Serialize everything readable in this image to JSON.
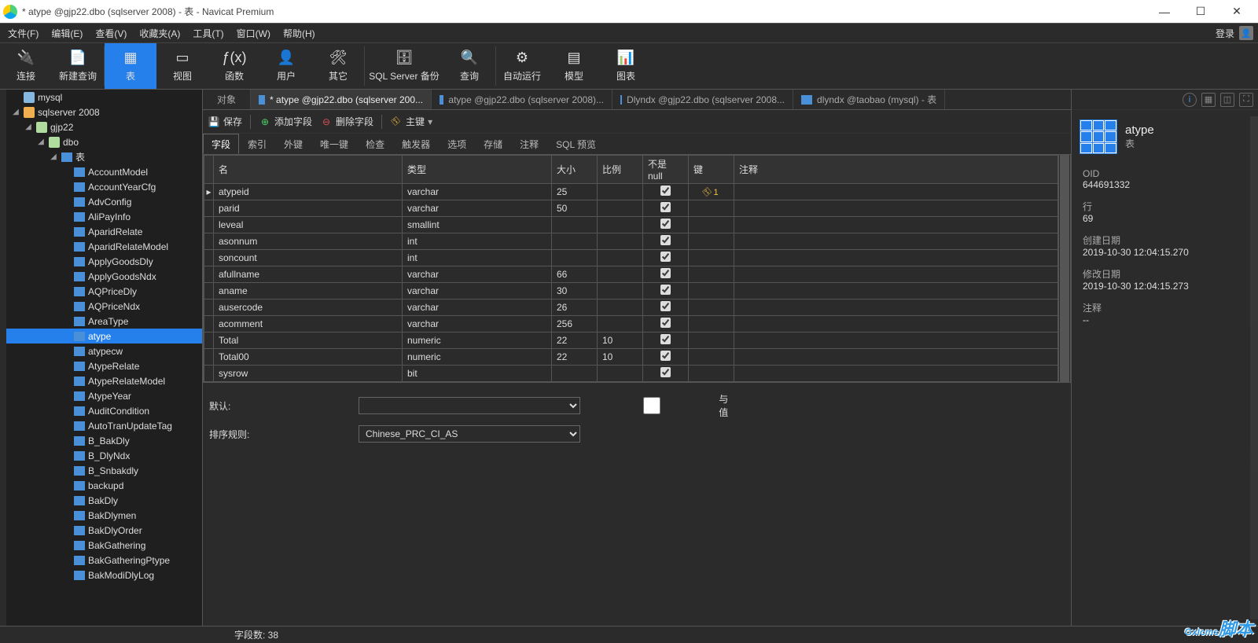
{
  "window": {
    "title": "* atype @gjp22.dbo (sqlserver 2008) - 表 - Navicat Premium"
  },
  "menu": {
    "items": [
      "文件(F)",
      "编辑(E)",
      "查看(V)",
      "收藏夹(A)",
      "工具(T)",
      "窗口(W)",
      "帮助(H)"
    ],
    "login": "登录"
  },
  "ribbon": {
    "items": [
      "连接",
      "新建查询",
      "表",
      "视图",
      "函数",
      "用户",
      "其它",
      "SQL Server 备份",
      "查询",
      "自动运行",
      "模型",
      "图表"
    ]
  },
  "tree": {
    "root": [
      {
        "label": "mysql",
        "icon": "my"
      },
      {
        "label": "sqlserver 2008",
        "icon": "sv",
        "open": true,
        "children": [
          {
            "label": "gjp22",
            "icon": "db",
            "open": true,
            "children": [
              {
                "label": "dbo",
                "icon": "db",
                "open": true,
                "children": [
                  {
                    "label": "表",
                    "icon": "tbl",
                    "open": true,
                    "children": [
                      {
                        "label": "AccountModel",
                        "icon": "tbl"
                      },
                      {
                        "label": "AccountYearCfg",
                        "icon": "tbl"
                      },
                      {
                        "label": "AdvConfig",
                        "icon": "tbl"
                      },
                      {
                        "label": "AliPayInfo",
                        "icon": "tbl"
                      },
                      {
                        "label": "AparidRelate",
                        "icon": "tbl"
                      },
                      {
                        "label": "AparidRelateModel",
                        "icon": "tbl"
                      },
                      {
                        "label": "ApplyGoodsDly",
                        "icon": "tbl"
                      },
                      {
                        "label": "ApplyGoodsNdx",
                        "icon": "tbl"
                      },
                      {
                        "label": "AQPriceDly",
                        "icon": "tbl"
                      },
                      {
                        "label": "AQPriceNdx",
                        "icon": "tbl"
                      },
                      {
                        "label": "AreaType",
                        "icon": "tbl"
                      },
                      {
                        "label": "atype",
                        "icon": "tbl",
                        "selected": true
                      },
                      {
                        "label": "atypecw",
                        "icon": "tbl"
                      },
                      {
                        "label": "AtypeRelate",
                        "icon": "tbl"
                      },
                      {
                        "label": "AtypeRelateModel",
                        "icon": "tbl"
                      },
                      {
                        "label": "AtypeYear",
                        "icon": "tbl"
                      },
                      {
                        "label": "AuditCondition",
                        "icon": "tbl"
                      },
                      {
                        "label": "AutoTranUpdateTag",
                        "icon": "tbl"
                      },
                      {
                        "label": "B_BakDly",
                        "icon": "tbl"
                      },
                      {
                        "label": "B_DlyNdx",
                        "icon": "tbl"
                      },
                      {
                        "label": "B_Snbakdly",
                        "icon": "tbl"
                      },
                      {
                        "label": "backupd",
                        "icon": "tbl"
                      },
                      {
                        "label": "BakDly",
                        "icon": "tbl"
                      },
                      {
                        "label": "BakDlymen",
                        "icon": "tbl"
                      },
                      {
                        "label": "BakDlyOrder",
                        "icon": "tbl"
                      },
                      {
                        "label": "BakGathering",
                        "icon": "tbl"
                      },
                      {
                        "label": "BakGatheringPtype",
                        "icon": "tbl"
                      },
                      {
                        "label": "BakModiDlyLog",
                        "icon": "tbl"
                      }
                    ]
                  }
                ]
              }
            ]
          }
        ]
      }
    ]
  },
  "tabs": {
    "obj": "对象",
    "items": [
      {
        "label": "* atype @gjp22.dbo (sqlserver 200...",
        "active": true
      },
      {
        "label": "atype @gjp22.dbo (sqlserver 2008)..."
      },
      {
        "label": "Dlyndx @gjp22.dbo (sqlserver 2008..."
      },
      {
        "label": "dlyndx @taobao (mysql) - 表"
      }
    ]
  },
  "toolbar2": {
    "save": "保存",
    "addfield": "添加字段",
    "delfield": "删除字段",
    "pk": "主键"
  },
  "subtabs": [
    "字段",
    "索引",
    "外键",
    "唯一键",
    "检查",
    "触发器",
    "选项",
    "存储",
    "注释",
    "SQL 预览"
  ],
  "grid": {
    "headers": [
      "名",
      "类型",
      "大小",
      "比例",
      "不是 null",
      "键",
      "注释"
    ],
    "rows": [
      {
        "ptr": true,
        "name": "atypeid",
        "type": "varchar",
        "size": "25",
        "scale": "",
        "nn": true,
        "key": "1"
      },
      {
        "name": "parid",
        "type": "varchar",
        "size": "50",
        "scale": "",
        "nn": true
      },
      {
        "name": "leveal",
        "type": "smallint",
        "size": "",
        "scale": "",
        "nn": true
      },
      {
        "name": "asonnum",
        "type": "int",
        "size": "",
        "scale": "",
        "nn": true
      },
      {
        "name": "soncount",
        "type": "int",
        "size": "",
        "scale": "",
        "nn": true
      },
      {
        "name": "afullname",
        "type": "varchar",
        "size": "66",
        "scale": "",
        "nn": true
      },
      {
        "name": "aname",
        "type": "varchar",
        "size": "30",
        "scale": "",
        "nn": true
      },
      {
        "name": "ausercode",
        "type": "varchar",
        "size": "26",
        "scale": "",
        "nn": true
      },
      {
        "name": "acomment",
        "type": "varchar",
        "size": "256",
        "scale": "",
        "nn": true
      },
      {
        "name": "Total",
        "type": "numeric",
        "size": "22",
        "scale": "10",
        "nn": true
      },
      {
        "name": "Total00",
        "type": "numeric",
        "size": "22",
        "scale": "10",
        "nn": true
      },
      {
        "name": "sysrow",
        "type": "bit",
        "size": "",
        "scale": "",
        "nn": true
      }
    ]
  },
  "form": {
    "default_label": "默认:",
    "collation_label": "排序规则:",
    "collation_value": "Chinese_PRC_CI_AS",
    "withvalue": "与值"
  },
  "right": {
    "name": "atype",
    "sub": "表",
    "props": [
      {
        "lab": "OID",
        "val": "644691332"
      },
      {
        "lab": "行",
        "val": "69"
      },
      {
        "lab": "创建日期",
        "val": "2019-10-30 12:04:15.270"
      },
      {
        "lab": "修改日期",
        "val": "2019-10-30 12:04:15.273"
      },
      {
        "lab": "注释",
        "val": "--"
      }
    ]
  },
  "status": {
    "fields": "字段数: 38"
  },
  "watermark": "Gxlcms"
}
